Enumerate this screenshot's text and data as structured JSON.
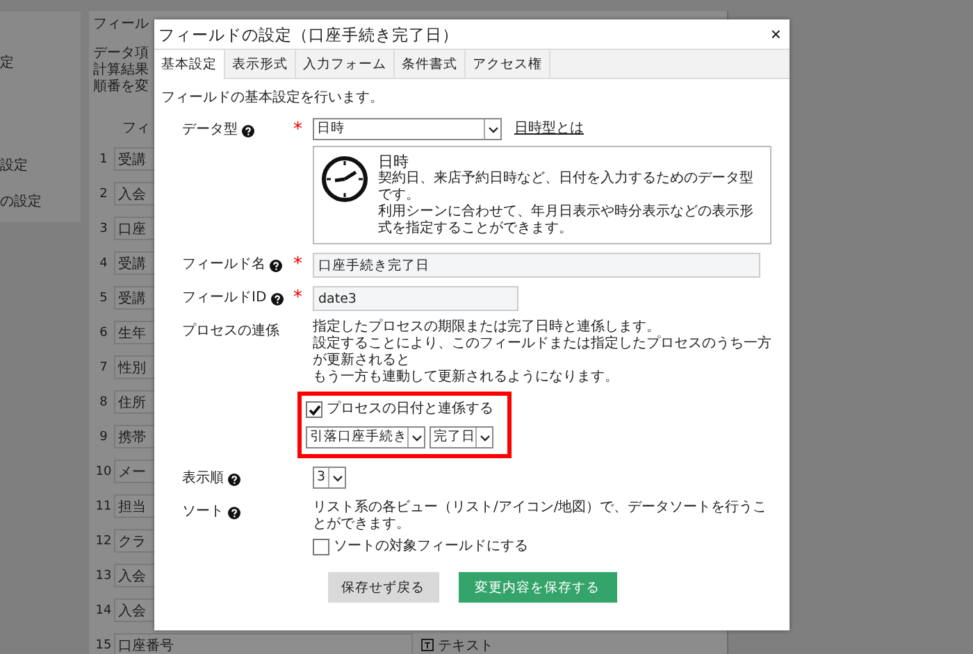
{
  "background": {
    "sidebar": [
      {
        "label": "定"
      },
      {
        "label": "設定"
      },
      {
        "label": "の設定"
      }
    ],
    "title": "フィール",
    "description": [
      "データ項",
      "計算結果",
      "順番を変"
    ],
    "column_header": "フィ",
    "rows": [
      {
        "number": "1",
        "name": "受講"
      },
      {
        "number": "2",
        "name": "入会"
      },
      {
        "number": "3",
        "name": "口座"
      },
      {
        "number": "4",
        "name": "受講"
      },
      {
        "number": "5",
        "name": "受講"
      },
      {
        "number": "6",
        "name": "生年"
      },
      {
        "number": "7",
        "name": "性別"
      },
      {
        "number": "8",
        "name": "住所"
      },
      {
        "number": "9",
        "name": "携帯"
      },
      {
        "number": "10",
        "name": "メー"
      },
      {
        "number": "11",
        "name": "担当"
      },
      {
        "number": "12",
        "name": "クラ"
      },
      {
        "number": "13",
        "name": "入会"
      },
      {
        "number": "14",
        "name": "入会"
      },
      {
        "number": "15",
        "name": "口座番号",
        "type": "テキスト"
      }
    ]
  },
  "dialog": {
    "title": "フィールドの設定（口座手続き完了日）",
    "close": "×",
    "tabs": [
      {
        "label": "基本設定",
        "selected": true
      },
      {
        "label": "表示形式",
        "selected": false
      },
      {
        "label": "入力フォーム",
        "selected": false
      },
      {
        "label": "条件書式",
        "selected": false
      },
      {
        "label": "アクセス権",
        "selected": false
      }
    ],
    "intro": "フィールドの基本設定を行います。",
    "data_type": {
      "label": "データ型",
      "required_mark": "*",
      "value": "日時",
      "link": "日時型とは",
      "info_title": "日時",
      "info_text": [
        "契約日、来店予約日時など、日付を入力するためのデータ型です。",
        "利用シーンに合わせて、年月日表示や時分表示などの表示形式を指定することができます。"
      ]
    },
    "field_name": {
      "label": "フィールド名",
      "required_mark": "*",
      "value": "口座手続き完了日"
    },
    "field_id": {
      "label": "フィールドID",
      "required_mark": "*",
      "value": "date3"
    },
    "process_link": {
      "label": "プロセスの連係",
      "text": [
        "指定したプロセスの期限または完了日時と連係します。",
        "設定することにより、このフィールドまたは指定したプロセスのうち一方が更新されると",
        "もう一方も連動して更新されるようになります。"
      ],
      "highlighted": true,
      "checkbox": {
        "label": "プロセスの日付と連係する",
        "checked": true
      },
      "selects": [
        "引落口座手続き",
        "完了日"
      ]
    },
    "display_order": {
      "label": "表示順",
      "value": "3"
    },
    "sort": {
      "label": "ソート",
      "text": "リスト系の各ビュー（リスト/アイコン/地図）で、データソートを行うことができます。",
      "checkbox": {
        "label": "ソートの対象フィールドにする",
        "checked": false
      }
    },
    "buttons": [
      {
        "label": "保存せず戻る",
        "kind": "secondary"
      },
      {
        "label": "変更内容を保存する",
        "kind": "primary"
      }
    ]
  }
}
